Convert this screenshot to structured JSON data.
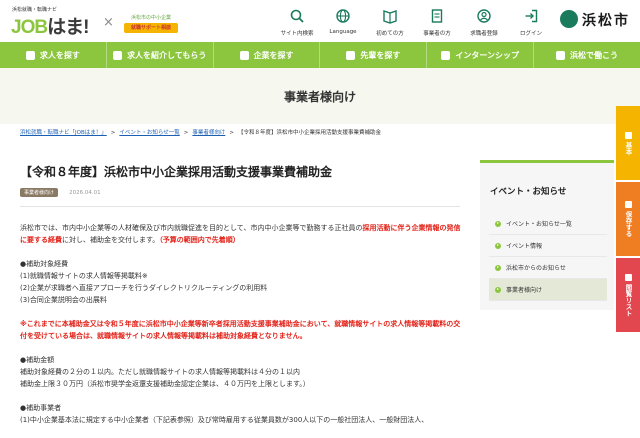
{
  "header": {
    "logo_sub": "浜松就職・転職ナビ",
    "logo_main_a": "JOB",
    "logo_main_b": "はま",
    "logo_main_c": "!",
    "logo_x": "×",
    "logo2_top": "浜松市の中小企業",
    "logo2_bottom": "就職サポート相談",
    "nav": [
      {
        "label": "サイト内検索",
        "icon": "search-icon"
      },
      {
        "label": "Language",
        "icon": "globe-icon"
      },
      {
        "label": "初めての方",
        "icon": "book-icon"
      },
      {
        "label": "事業者の方",
        "icon": "document-icon"
      },
      {
        "label": "求職者登録",
        "icon": "user-icon"
      },
      {
        "label": "ログイン",
        "icon": "login-icon"
      }
    ],
    "city_name": "浜松市"
  },
  "global_nav": [
    "求人を探す",
    "求人を紹介してもらう",
    "企業を探す",
    "先輩を探す",
    "インターンシップ",
    "浜松で働こう"
  ],
  "page_title": "事業者様向け",
  "breadcrumb": {
    "items": [
      "浜松就職・転職ナビ「JOBはま！」",
      "イベント・お知らせ一覧",
      "事業者様向け"
    ],
    "current": "【令和８年度】浜松市中小企業採用活動支援事業費補助金"
  },
  "article": {
    "title": "【令和８年度】浜松市中小企業採用活動支援事業費補助金",
    "badge": "事業者様向け",
    "date": "2026.04.01",
    "intro_1": "浜松市では、市内中小企業等の人材確保及び市内就職促進を目的として、市内中小企業等で勤務する正社員の",
    "intro_red": "採用活動に伴う企業情報の発信に要する経費",
    "intro_2": "に対し、補助金を交付します。",
    "intro_red2": "（予算の範囲内で先着順）",
    "target_head": "●補助対象経費",
    "target_lines": [
      "(1)就職情報サイトの求人情報等掲載料※",
      "(2)企業が求職者へ直接アプローチを行うダイレクトリクルーティングの利用料",
      "(3)合同企業説明会の出展料"
    ],
    "notice": "※これまでに本補助金又は令和５年度に浜松市中小企業等新卒者採用活動支援事業補助金において、就職情報サイトの求人情報等掲載料の交付を受けている場合は、就職情報サイトの求人情報等掲載料は補助対象経費となりません。",
    "amount_head": "●補助金額",
    "amount_lines": [
      "補助対象経費の２分の１以内。ただし就職情報サイトの求人情報等掲載料は４分の１以内",
      "補助金上限３０万円（浜松市奨学金返還支援補助金認定企業は、４０万円を上限とします。）"
    ],
    "business_head": "●補助事業者",
    "business_line": "(1)中小企業基本法に規定する中小企業者（下記表参照）及び常時雇用する従業員数が300人以下の一般社団法人、一般財団法人、"
  },
  "sidebar": {
    "title": "イベント・お知らせ",
    "items": [
      "イベント・お知らせ一覧",
      "イベント情報",
      "浜松市からのお知らせ",
      "事業者様向け"
    ],
    "active_index": 3
  },
  "side_tabs": [
    {
      "label": "基本",
      "color": "#f4b400"
    },
    {
      "label": "保存する",
      "color": "#ef7d22"
    },
    {
      "label": "閲覧リスト",
      "color": "#e2474f"
    }
  ]
}
